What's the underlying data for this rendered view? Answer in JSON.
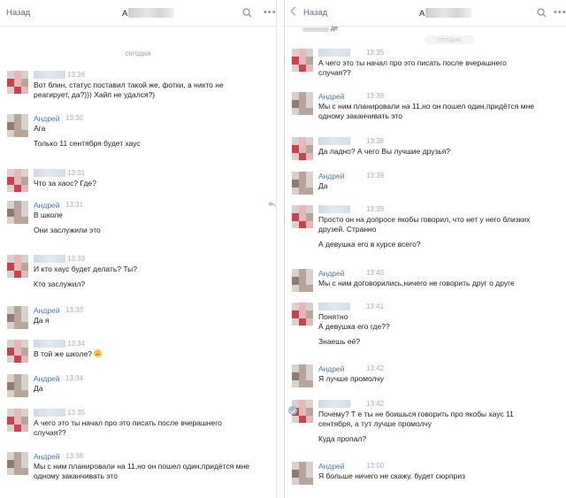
{
  "left": {
    "back_label": "Назад",
    "title_initial": "А",
    "day_separator": "сегодня",
    "messages": [
      {
        "author": "",
        "time": "13:26",
        "lines": [
          "Вот блин, статус поставил такой же, фотки, а никто не",
          "реагирует, да?))) Хайп не удался?)"
        ]
      },
      {
        "author": "Андрей",
        "time": "13:30",
        "lines": [
          "Ага",
          "",
          "Только 11 сентября будет хаус"
        ]
      },
      {
        "author": "",
        "time": "13:31",
        "lines": [
          "Что за хаос? Где?"
        ]
      },
      {
        "author": "Андрей",
        "time": "13:31",
        "lines": [
          "В школе",
          "",
          "Они заслужили это"
        ]
      },
      {
        "author": "",
        "time": "13:33",
        "lines": [
          "И кто хаус будет делать? Ты?",
          "",
          "Кто заслужил?"
        ]
      },
      {
        "author": "Андрей",
        "time": "13:33",
        "lines": [
          "Да я"
        ]
      },
      {
        "author": "",
        "time": "13:34",
        "lines": [
          "В той же школе?"
        ]
      },
      {
        "author": "Андрей",
        "time": "13:34",
        "lines": [
          "Да"
        ]
      },
      {
        "author": "",
        "time": "13:35",
        "lines": [
          "А чего это ты начал про это писать после вчерашнего",
          "случая??"
        ]
      },
      {
        "author": "Андрей",
        "time": "13:38",
        "lines": [
          "Мы с ним планировали на 11,но он пошел один,придётся мне",
          "одному заканчивать это"
        ]
      }
    ]
  },
  "right": {
    "back_label": "Назад",
    "title_initial": "А",
    "day_separator": "сегодня",
    "top_partial_text": "де",
    "messages": [
      {
        "author": "",
        "time": "13:35",
        "lines": [
          "А чего это ты начал про это писать после вчерашнего",
          "случая??"
        ]
      },
      {
        "author": "Андрей",
        "time": "13:38",
        "lines": [
          "Мы с ним планировали на 11,но он пошел один,придётся мне",
          "одному заканчивать это"
        ]
      },
      {
        "author": "",
        "time": "13:38",
        "lines": [
          "Да ладно? А чего Вы лучшие друзья?"
        ]
      },
      {
        "author": "Андрей",
        "time": "13:39",
        "lines": [
          "Да"
        ]
      },
      {
        "author": "",
        "time": "13:39",
        "lines": [
          "Просто он на допросе якобы говорил, что нет у него близких",
          "друзей. Странно",
          "",
          "А девушка его в курсе всего?"
        ]
      },
      {
        "author": "Андрей",
        "time": "13:40",
        "lines": [
          "Мы с ним договорились,ничего не говорить друг о друге"
        ]
      },
      {
        "author": "",
        "time": "13:41",
        "lines": [
          "Понятно",
          "А девушка его где??",
          "",
          "Знаешь её?"
        ]
      },
      {
        "author": "Андрей",
        "time": "13:42",
        "lines": [
          "Я лучше промолчу"
        ]
      },
      {
        "author": "",
        "time": "13:42",
        "lines": [
          "Почему? Т е ты не боишься говорить про якобы хаус 11",
          "сентября, а тут лучше промолчу",
          "",
          "Куда пропал?"
        ]
      },
      {
        "author": "Андрей",
        "time": "13:50",
        "lines": [
          "Я больше ничего не скажу, будет сюрприз"
        ]
      }
    ]
  },
  "icons": {
    "search": "search-icon",
    "more": "more-dots-icon",
    "back": "chevron-left-icon",
    "reply": "reply-arrow-icon",
    "read": "read-check-icon",
    "emoji": "worried-face-emoji-icon"
  },
  "colors": {
    "author_name": "#4a76a8",
    "timestamp": "#a7afb8",
    "text": "#222222"
  }
}
